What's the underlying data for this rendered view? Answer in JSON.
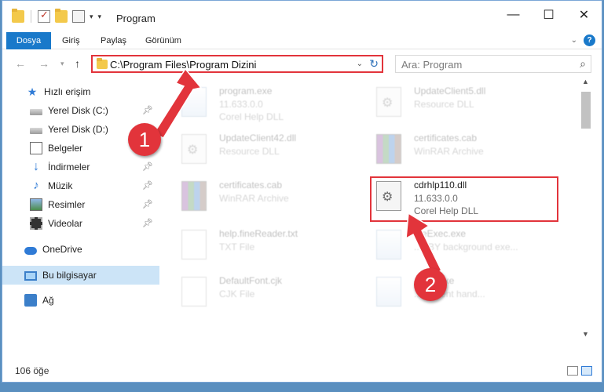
{
  "window": {
    "title": "Program",
    "controls": {
      "minimize": "—",
      "maximize": "☐",
      "close": "✕"
    }
  },
  "ribbon": {
    "tabs": [
      "Dosya",
      "Giriş",
      "Paylaş",
      "Görünüm"
    ],
    "active_tab": "Dosya",
    "help": "?"
  },
  "address_bar": {
    "path": "C:\\Program Files\\Program Dizini",
    "search_placeholder": "Ara: Program"
  },
  "sidebar": {
    "items": [
      {
        "label": "Hızlı erişim",
        "icon": "star-icon"
      },
      {
        "label": "Yerel Disk (C:)",
        "icon": "disk-icon",
        "pinned": true
      },
      {
        "label": "Yerel Disk (D:)",
        "icon": "disk-icon"
      },
      {
        "label": "Belgeler",
        "icon": "documents-icon",
        "pinned": true
      },
      {
        "label": "İndirmeler",
        "icon": "download-icon",
        "pinned": true
      },
      {
        "label": "Müzik",
        "icon": "music-icon",
        "pinned": true
      },
      {
        "label": "Resimler",
        "icon": "pictures-icon",
        "pinned": true
      },
      {
        "label": "Videolar",
        "icon": "video-icon",
        "pinned": true
      },
      {
        "label": "OneDrive",
        "icon": "cloud-icon"
      },
      {
        "label": "Bu bilgisayar",
        "icon": "computer-icon",
        "selected": true
      },
      {
        "label": "Ağ",
        "icon": "network-icon"
      }
    ]
  },
  "files": [
    {
      "name": "program.exe",
      "line2": "11.633.0.0",
      "line3": "Corel Help DLL",
      "type": "exe",
      "faded": true
    },
    {
      "name": "UpdateClient5.dll",
      "line2": "Resource DLL",
      "line3": "",
      "type": "dll",
      "faded": true
    },
    {
      "name": "UpdateClient42.dll",
      "line2": "Resource DLL",
      "line3": "",
      "type": "dll",
      "faded": true
    },
    {
      "name": "certificates.cab",
      "line2": "WinRAR Archive",
      "line3": "",
      "type": "cab",
      "faded": true
    },
    {
      "name": "certificates.cab",
      "line2": "WinRAR Archive",
      "line3": "",
      "type": "cab",
      "faded": true
    },
    {
      "name": "cdrhlp110.dll",
      "line2": "11.633.0.0",
      "line3": "Corel Help DLL",
      "type": "dll",
      "faded": false
    },
    {
      "name": "help.fineReader.txt",
      "line2": "TXT File",
      "line3": "",
      "type": "txt",
      "faded": true
    },
    {
      "name": "...eExec.exe",
      "line2": "...BBY background exe...",
      "line3": "",
      "type": "exe",
      "faded": true
    },
    {
      "name": "DefaultFont.cjk",
      "line2": "CJK File",
      "line3": "",
      "type": "txt",
      "faded": true
    },
    {
      "name": "...STI.exe",
      "line2": "...S event hand...",
      "line3": "",
      "type": "exe",
      "faded": true
    }
  ],
  "status": {
    "item_count": "106 öğe"
  },
  "annotations": {
    "step1": "1",
    "step2": "2"
  },
  "colors": {
    "accent": "#1979ca",
    "highlight": "#e2343b"
  }
}
